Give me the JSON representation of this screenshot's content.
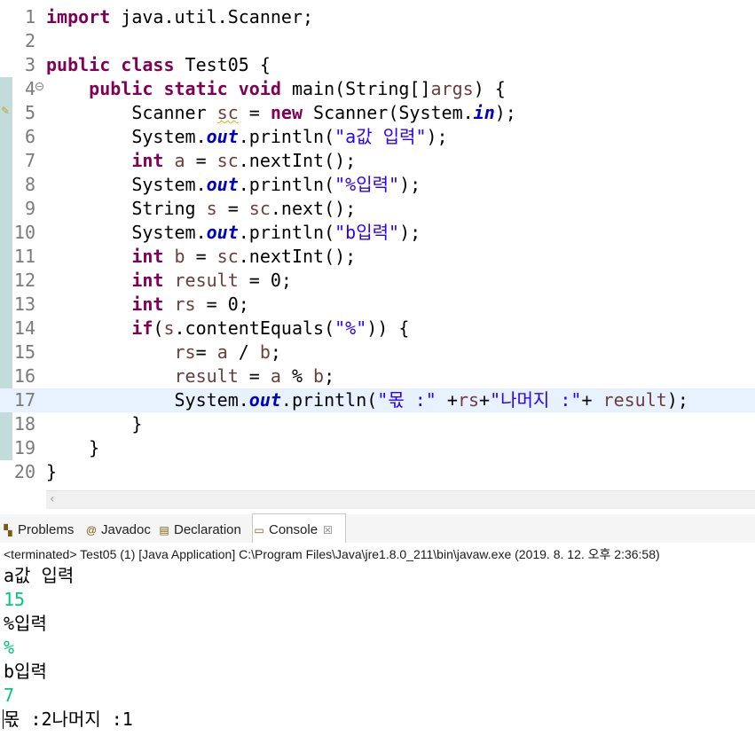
{
  "editor": {
    "lines": [
      {
        "num": "1",
        "tokens": [
          {
            "t": "kw",
            "v": "import"
          },
          {
            "t": "plain",
            "v": " java.util.Scanner;"
          }
        ]
      },
      {
        "num": "2",
        "tokens": []
      },
      {
        "num": "3",
        "tokens": [
          {
            "t": "kw",
            "v": "public"
          },
          {
            "t": "plain",
            "v": " "
          },
          {
            "t": "kw",
            "v": "class"
          },
          {
            "t": "plain",
            "v": " Test05 {"
          }
        ]
      },
      {
        "num": "4",
        "tokens": [
          {
            "t": "plain",
            "v": "    "
          },
          {
            "t": "kw",
            "v": "public"
          },
          {
            "t": "plain",
            "v": " "
          },
          {
            "t": "kw",
            "v": "static"
          },
          {
            "t": "plain",
            "v": " "
          },
          {
            "t": "kw",
            "v": "void"
          },
          {
            "t": "plain",
            "v": " main(String[]"
          },
          {
            "t": "var",
            "v": "args"
          },
          {
            "t": "plain",
            "v": ") {"
          }
        ]
      },
      {
        "num": "5",
        "tokens": [
          {
            "t": "plain",
            "v": "        Scanner "
          },
          {
            "t": "var squiggle",
            "v": "sc"
          },
          {
            "t": "plain",
            "v": " = "
          },
          {
            "t": "kw",
            "v": "new"
          },
          {
            "t": "plain",
            "v": " Scanner(System."
          },
          {
            "t": "field",
            "v": "in"
          },
          {
            "t": "plain",
            "v": ");"
          }
        ]
      },
      {
        "num": "6",
        "tokens": [
          {
            "t": "plain",
            "v": "        System."
          },
          {
            "t": "field",
            "v": "out"
          },
          {
            "t": "plain",
            "v": ".println("
          },
          {
            "t": "str",
            "v": "\"a값 입력\""
          },
          {
            "t": "plain",
            "v": ");"
          }
        ]
      },
      {
        "num": "7",
        "tokens": [
          {
            "t": "plain",
            "v": "        "
          },
          {
            "t": "kw",
            "v": "int"
          },
          {
            "t": "plain",
            "v": " "
          },
          {
            "t": "var",
            "v": "a"
          },
          {
            "t": "plain",
            "v": " = "
          },
          {
            "t": "var",
            "v": "sc"
          },
          {
            "t": "plain",
            "v": ".nextInt();"
          }
        ]
      },
      {
        "num": "8",
        "tokens": [
          {
            "t": "plain",
            "v": "        System."
          },
          {
            "t": "field",
            "v": "out"
          },
          {
            "t": "plain",
            "v": ".println("
          },
          {
            "t": "str",
            "v": "\"%입력\""
          },
          {
            "t": "plain",
            "v": ");"
          }
        ]
      },
      {
        "num": "9",
        "tokens": [
          {
            "t": "plain",
            "v": "        String "
          },
          {
            "t": "var",
            "v": "s"
          },
          {
            "t": "plain",
            "v": " = "
          },
          {
            "t": "var",
            "v": "sc"
          },
          {
            "t": "plain",
            "v": ".next();"
          }
        ]
      },
      {
        "num": "10",
        "tokens": [
          {
            "t": "plain",
            "v": "        System."
          },
          {
            "t": "field",
            "v": "out"
          },
          {
            "t": "plain",
            "v": ".println("
          },
          {
            "t": "str",
            "v": "\"b입력\""
          },
          {
            "t": "plain",
            "v": ");"
          }
        ]
      },
      {
        "num": "11",
        "tokens": [
          {
            "t": "plain",
            "v": "        "
          },
          {
            "t": "kw",
            "v": "int"
          },
          {
            "t": "plain",
            "v": " "
          },
          {
            "t": "var",
            "v": "b"
          },
          {
            "t": "plain",
            "v": " = "
          },
          {
            "t": "var",
            "v": "sc"
          },
          {
            "t": "plain",
            "v": ".nextInt();"
          }
        ]
      },
      {
        "num": "12",
        "tokens": [
          {
            "t": "plain",
            "v": "        "
          },
          {
            "t": "kw",
            "v": "int"
          },
          {
            "t": "plain",
            "v": " "
          },
          {
            "t": "var",
            "v": "result"
          },
          {
            "t": "plain",
            "v": " = 0;"
          }
        ]
      },
      {
        "num": "13",
        "tokens": [
          {
            "t": "plain",
            "v": "        "
          },
          {
            "t": "kw",
            "v": "int"
          },
          {
            "t": "plain",
            "v": " "
          },
          {
            "t": "var",
            "v": "rs"
          },
          {
            "t": "plain",
            "v": " = 0;"
          }
        ]
      },
      {
        "num": "14",
        "tokens": [
          {
            "t": "plain",
            "v": "        "
          },
          {
            "t": "kw",
            "v": "if"
          },
          {
            "t": "plain",
            "v": "("
          },
          {
            "t": "var",
            "v": "s"
          },
          {
            "t": "plain",
            "v": ".contentEquals("
          },
          {
            "t": "str",
            "v": "\"%\""
          },
          {
            "t": "plain",
            "v": ")) {"
          }
        ]
      },
      {
        "num": "15",
        "tokens": [
          {
            "t": "plain",
            "v": "            "
          },
          {
            "t": "var",
            "v": "rs"
          },
          {
            "t": "plain",
            "v": "= "
          },
          {
            "t": "var",
            "v": "a"
          },
          {
            "t": "plain",
            "v": " / "
          },
          {
            "t": "var",
            "v": "b"
          },
          {
            "t": "plain",
            "v": ";"
          }
        ]
      },
      {
        "num": "16",
        "tokens": [
          {
            "t": "plain",
            "v": "            "
          },
          {
            "t": "var",
            "v": "result"
          },
          {
            "t": "plain",
            "v": " = "
          },
          {
            "t": "var",
            "v": "a"
          },
          {
            "t": "plain",
            "v": " % "
          },
          {
            "t": "var",
            "v": "b"
          },
          {
            "t": "plain",
            "v": ";"
          }
        ]
      },
      {
        "num": "17",
        "current": true,
        "tokens": [
          {
            "t": "plain",
            "v": "            System."
          },
          {
            "t": "field",
            "v": "out"
          },
          {
            "t": "plain",
            "v": ".println("
          },
          {
            "t": "str",
            "v": "\"몫 :\""
          },
          {
            "t": "plain",
            "v": " +"
          },
          {
            "t": "var",
            "v": "rs"
          },
          {
            "t": "plain",
            "v": "+"
          },
          {
            "t": "str",
            "v": "\"나머지 :\""
          },
          {
            "t": "plain",
            "v": "+ "
          },
          {
            "t": "var",
            "v": "result"
          },
          {
            "t": "plain",
            "v": ");"
          }
        ]
      },
      {
        "num": "18",
        "tokens": [
          {
            "t": "plain",
            "v": "        }"
          }
        ]
      },
      {
        "num": "19",
        "tokens": [
          {
            "t": "plain",
            "v": "    }"
          }
        ]
      },
      {
        "num": "20",
        "tokens": [
          {
            "t": "plain",
            "v": "}"
          }
        ]
      }
    ],
    "fold_icon": "collapse-icon",
    "warning_icon": "warning-lightbulb-icon"
  },
  "views": {
    "tabs": [
      {
        "label": "Problems",
        "icon": "problems-icon",
        "glyph": "▚"
      },
      {
        "label": "Javadoc",
        "icon": "javadoc-icon",
        "glyph": "@"
      },
      {
        "label": "Declaration",
        "icon": "declaration-icon",
        "glyph": "▤"
      },
      {
        "label": "Console",
        "icon": "console-icon",
        "glyph": "▭",
        "active": true
      }
    ],
    "close_glyph": "☒"
  },
  "console": {
    "header": "<terminated> Test05 (1) [Java Application] C:\\Program Files\\Java\\jre1.8.0_211\\bin\\javaw.exe (2019. 8. 12. 오후 2:36:58)",
    "output": [
      {
        "text": "a값 입력",
        "kind": "stdout"
      },
      {
        "text": "15",
        "kind": "input"
      },
      {
        "text": "%입력",
        "kind": "stdout"
      },
      {
        "text": "%",
        "kind": "input"
      },
      {
        "text": "b입력",
        "kind": "stdout"
      },
      {
        "text": "7",
        "kind": "input"
      },
      {
        "text": "몫 :2나머지 :1",
        "kind": "stdout"
      }
    ]
  },
  "colors": {
    "keyword": "#7f0055",
    "string": "#2a00ff",
    "field": "#0000c0",
    "local_var": "#6a3e3e",
    "console_input": "#00c87d",
    "current_line": "#e8f2fe"
  }
}
